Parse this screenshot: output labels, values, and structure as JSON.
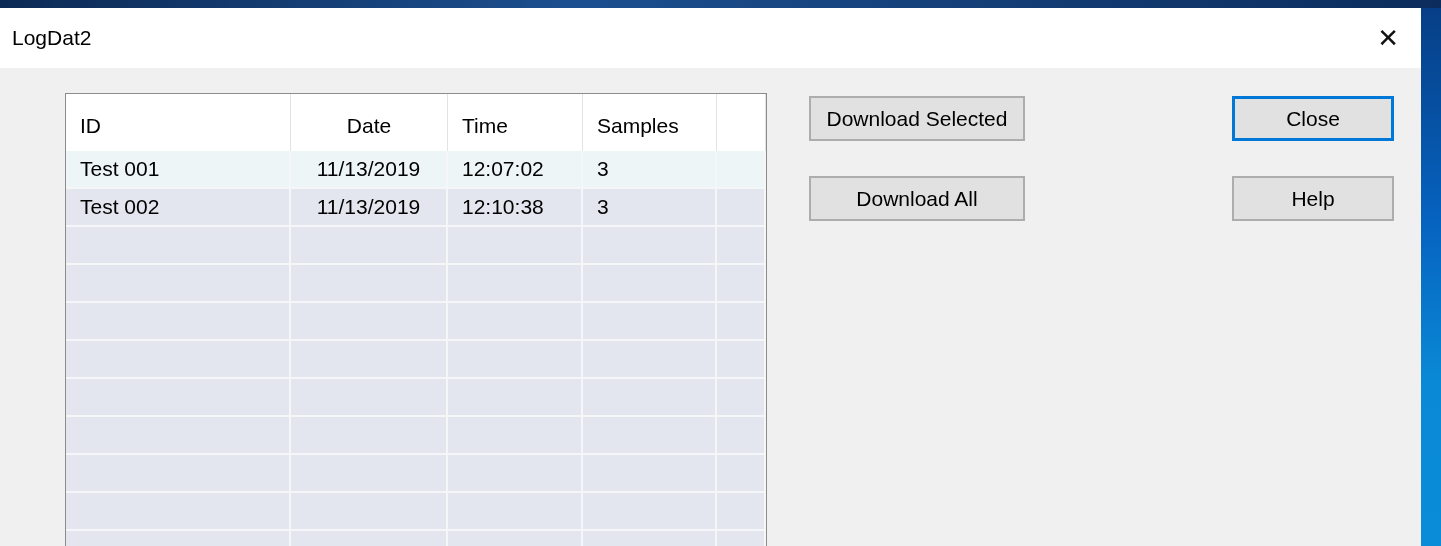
{
  "window": {
    "title": "LogDat2",
    "close_glyph": "✕"
  },
  "table": {
    "columns": [
      "ID",
      "Date",
      "Time",
      "Samples"
    ],
    "rows": [
      {
        "cells": [
          "Test 001",
          "11/13/2019",
          "12:07:02",
          "3"
        ],
        "selected": true
      },
      {
        "cells": [
          "Test 002",
          "11/13/2019",
          "12:10:38",
          "3"
        ],
        "selected": false
      }
    ]
  },
  "buttons": [
    {
      "label": "Download Selected",
      "default": false
    },
    {
      "label": "Download All",
      "default": false
    }
  ],
  "side_buttons": [
    {
      "label": "Close",
      "default": true
    },
    {
      "label": "Help",
      "default": false
    }
  ]
}
